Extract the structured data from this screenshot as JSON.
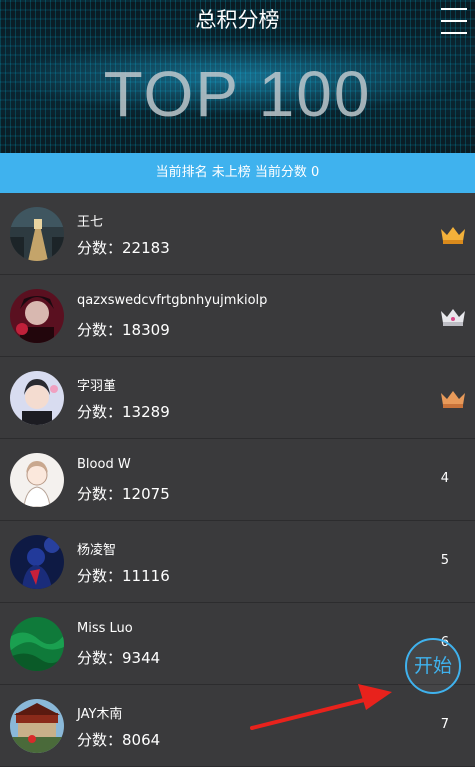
{
  "header": {
    "title": "总积分榜",
    "banner_text": "TOP 100"
  },
  "status_line": "当前排名 未上榜  当前分数 0",
  "score_prefix": "分数：",
  "entries": [
    {
      "name": "王七",
      "score": "22183",
      "rank_display": "crown",
      "crown_color": "#f3b13a"
    },
    {
      "name": "qazxswedcvfrtgbnhyujmkiolp",
      "score": "18309",
      "rank_display": "crown",
      "crown_color": "#e8e8ec"
    },
    {
      "name": "字羽堇",
      "score": "13289",
      "rank_display": "crown",
      "crown_color": "#e89a5a"
    },
    {
      "name": "Blood W",
      "score": "12075",
      "rank_display": "4"
    },
    {
      "name": "杨凌智",
      "score": "11116",
      "rank_display": "5"
    },
    {
      "name": "Miss Luo",
      "score": "9344",
      "rank_display": "6"
    },
    {
      "name": "JAY木南",
      "score": "8064",
      "rank_display": "7"
    }
  ],
  "start_button": {
    "label": "开始"
  },
  "colors": {
    "accent": "#3fb2ee",
    "row_bg": "#3a3a3c",
    "arrow": "#e8221c"
  }
}
